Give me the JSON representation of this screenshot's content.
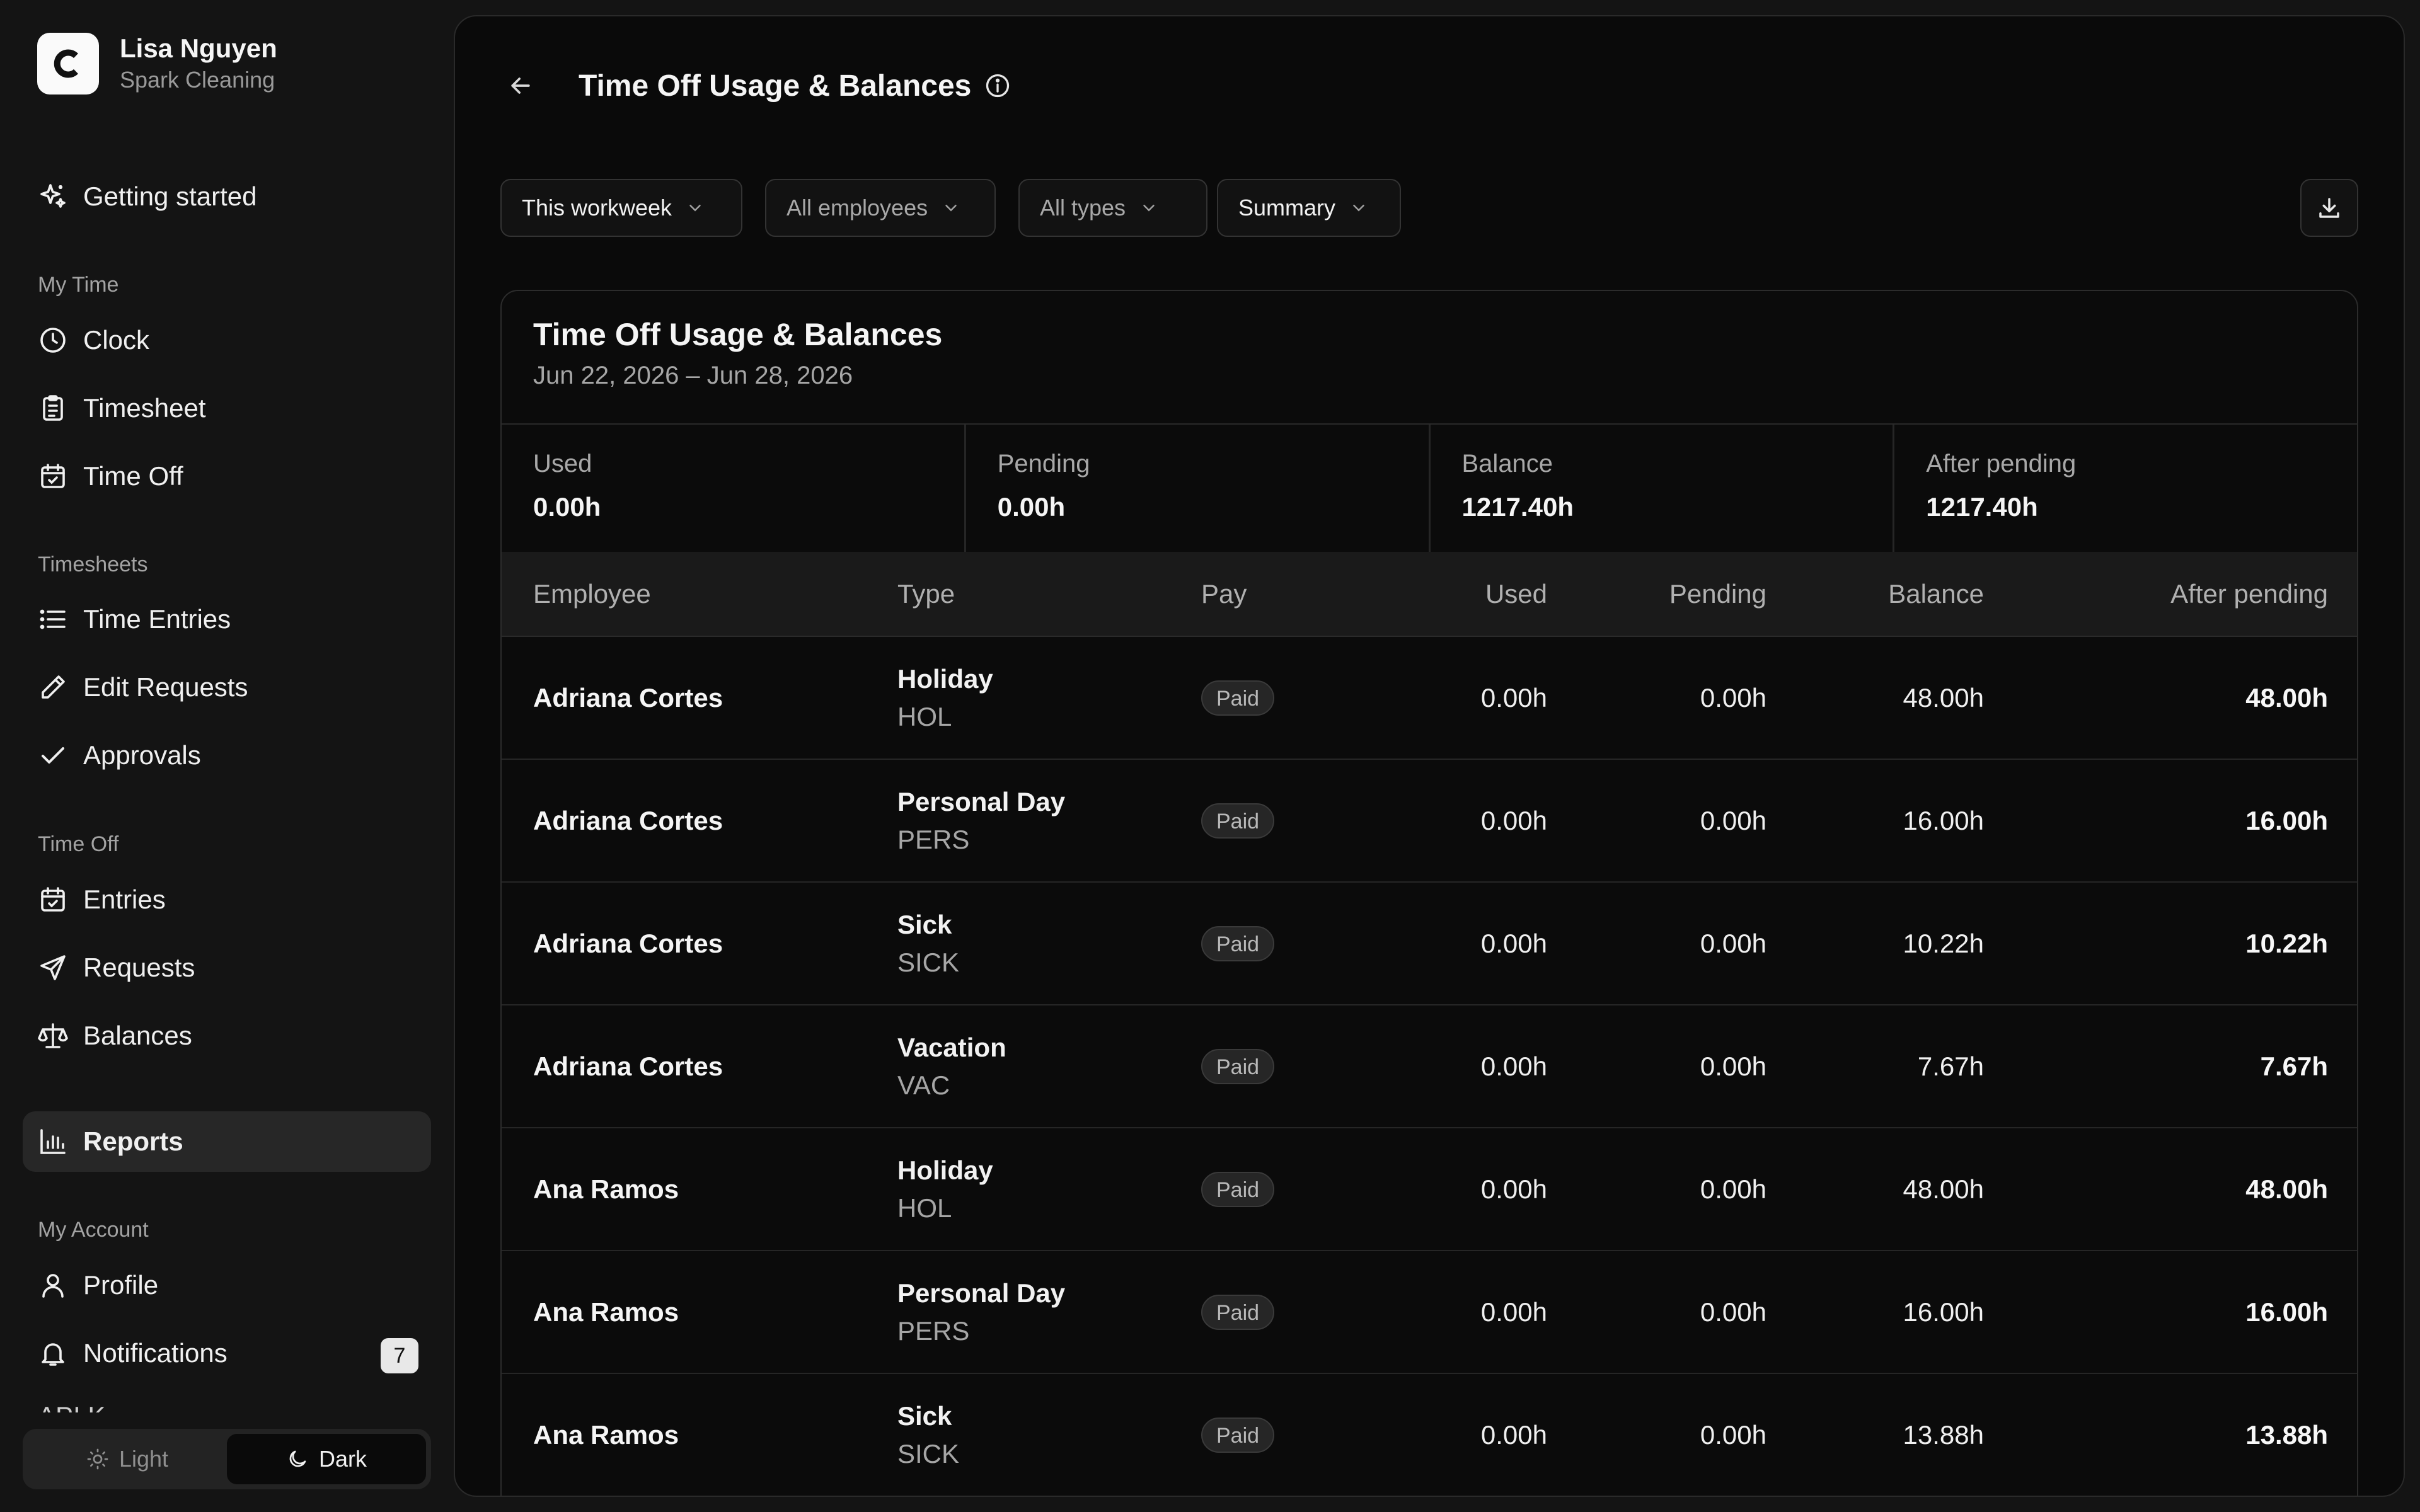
{
  "user": {
    "name": "Lisa Nguyen",
    "org": "Spark Cleaning"
  },
  "sidebar": {
    "getting_started": "Getting started",
    "sections": {
      "my_time": "My Time",
      "timesheets": "Timesheets",
      "time_off": "Time Off",
      "my_account": "My Account"
    },
    "my_time": {
      "clock": "Clock",
      "timesheet": "Timesheet",
      "time_off": "Time Off"
    },
    "timesheets": {
      "time_entries": "Time Entries",
      "edit_requests": "Edit Requests",
      "approvals": "Approvals"
    },
    "time_off": {
      "entries": "Entries",
      "requests": "Requests",
      "balances": "Balances"
    },
    "reports": "Reports",
    "my_account": {
      "profile": "Profile",
      "notifications": "Notifications",
      "notifications_count": "7",
      "api_peek": "API K"
    },
    "theme": {
      "light": "Light",
      "dark": "Dark",
      "selected": "Dark"
    }
  },
  "header": {
    "title": "Time Off Usage & Balances"
  },
  "filters": {
    "period": "This workweek",
    "employees": "All employees",
    "types": "All types",
    "view": "Summary"
  },
  "card": {
    "title": "Time Off Usage & Balances",
    "range": "Jun 22, 2026 – Jun 28, 2026",
    "stats": {
      "used_label": "Used",
      "used_value": "0.00h",
      "pending_label": "Pending",
      "pending_value": "0.00h",
      "balance_label": "Balance",
      "balance_value": "1217.40h",
      "after_label": "After pending",
      "after_value": "1217.40h"
    }
  },
  "table": {
    "columns": [
      "Employee",
      "Type",
      "Pay",
      "Used",
      "Pending",
      "Balance",
      "After pending"
    ],
    "rows": [
      {
        "employee": "Adriana Cortes",
        "type": "Holiday",
        "code": "HOL",
        "pay": "Paid",
        "used": "0.00h",
        "pending": "0.00h",
        "balance": "48.00h",
        "after": "48.00h"
      },
      {
        "employee": "Adriana Cortes",
        "type": "Personal Day",
        "code": "PERS",
        "pay": "Paid",
        "used": "0.00h",
        "pending": "0.00h",
        "balance": "16.00h",
        "after": "16.00h"
      },
      {
        "employee": "Adriana Cortes",
        "type": "Sick",
        "code": "SICK",
        "pay": "Paid",
        "used": "0.00h",
        "pending": "0.00h",
        "balance": "10.22h",
        "after": "10.22h"
      },
      {
        "employee": "Adriana Cortes",
        "type": "Vacation",
        "code": "VAC",
        "pay": "Paid",
        "used": "0.00h",
        "pending": "0.00h",
        "balance": "7.67h",
        "after": "7.67h"
      },
      {
        "employee": "Ana Ramos",
        "type": "Holiday",
        "code": "HOL",
        "pay": "Paid",
        "used": "0.00h",
        "pending": "0.00h",
        "balance": "48.00h",
        "after": "48.00h"
      },
      {
        "employee": "Ana Ramos",
        "type": "Personal Day",
        "code": "PERS",
        "pay": "Paid",
        "used": "0.00h",
        "pending": "0.00h",
        "balance": "16.00h",
        "after": "16.00h"
      },
      {
        "employee": "Ana Ramos",
        "type": "Sick",
        "code": "SICK",
        "pay": "Paid",
        "used": "0.00h",
        "pending": "0.00h",
        "balance": "13.88h",
        "after": "13.88h"
      }
    ]
  }
}
